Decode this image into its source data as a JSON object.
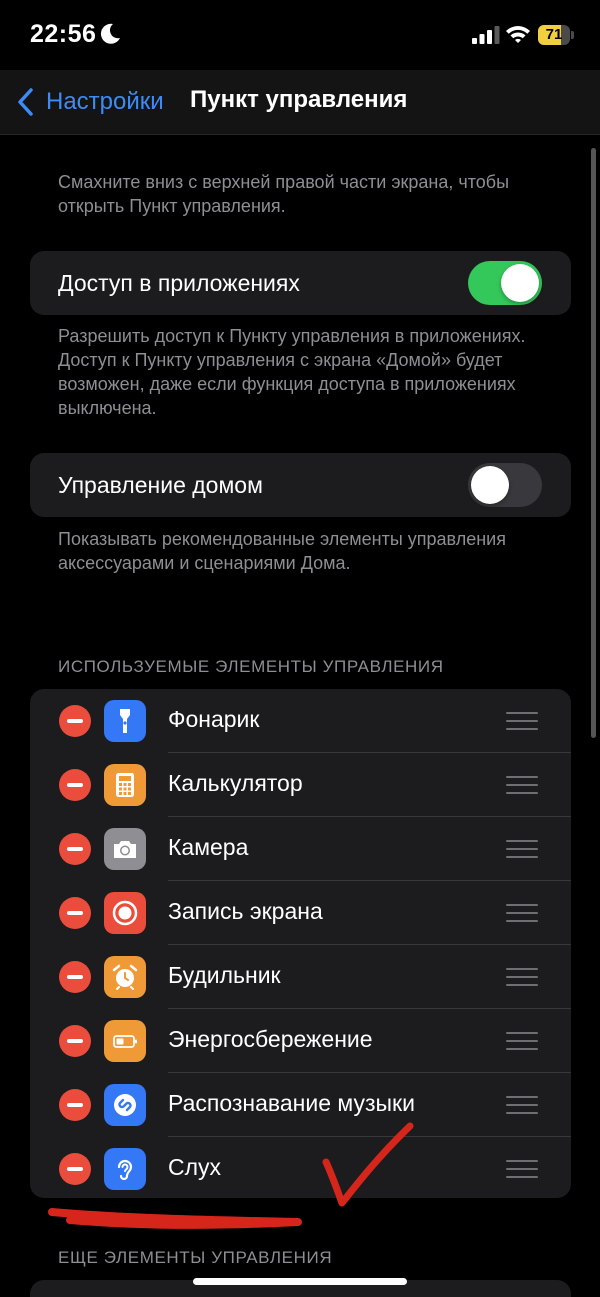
{
  "status": {
    "time": "22:56",
    "battery": "71",
    "battery_level": 0.71
  },
  "nav": {
    "back_label": "Настройки",
    "title": "Пункт управления"
  },
  "intro": "Смахните вниз с верхней правой части экрана, чтобы открыть Пункт управления.",
  "access": {
    "label": "Доступ в приложениях",
    "on": true,
    "footer": "Разрешить доступ к Пункту управления в приложениях. Доступ к Пункту управления с экрана «Домой» будет возможен, даже если функция доступа в приложениях выключена."
  },
  "home": {
    "label": "Управление домом",
    "on": false,
    "footer": "Показывать рекомендованные элементы управления аксессуарами и сценариями Дома."
  },
  "included": {
    "header": "ИСПОЛЬЗУЕМЫЕ ЭЛЕМЕНТЫ УПРАВЛЕНИЯ",
    "items": [
      {
        "label": "Фонарик",
        "icon": "flashlight-icon",
        "color": "#3478f6"
      },
      {
        "label": "Калькулятор",
        "icon": "calculator-icon",
        "color": "#f09a37"
      },
      {
        "label": "Камера",
        "icon": "camera-icon",
        "color": "#8e8e93"
      },
      {
        "label": "Запись экрана",
        "icon": "screen-record-icon",
        "color": "#eb4d3d"
      },
      {
        "label": "Будильник",
        "icon": "alarm-icon",
        "color": "#f09a37"
      },
      {
        "label": "Энергосбережение",
        "icon": "battery-saver-icon",
        "color": "#f09a37"
      },
      {
        "label": "Распознавание музыки",
        "icon": "shazam-icon",
        "color": "#3478f6"
      },
      {
        "label": "Слух",
        "icon": "hearing-icon",
        "color": "#3478f6"
      }
    ]
  },
  "more": {
    "header": "ЕЩЕ ЭЛЕМЕНТЫ УПРАВЛЕНИЯ"
  }
}
